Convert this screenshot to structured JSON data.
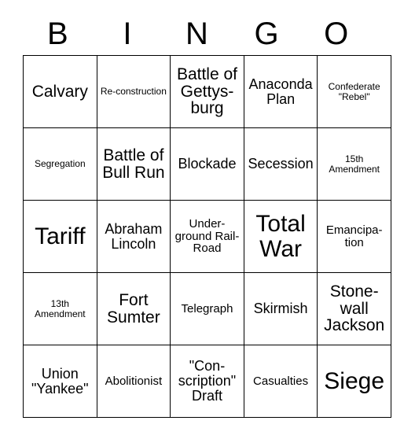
{
  "card": {
    "header_letters": [
      "B",
      "I",
      "N",
      "G",
      "O"
    ],
    "grid_line_color": "#000000",
    "background_color": "#ffffff",
    "text_color": "#000000",
    "rows": [
      [
        {
          "text": "Calvary",
          "size": "lg"
        },
        {
          "text": "Re-construction",
          "size": "xs"
        },
        {
          "text": "Battle of Gettys-burg",
          "size": "lg"
        },
        {
          "text": "Anaconda Plan",
          "size": "md"
        },
        {
          "text": "Confederate \"Rebel\"",
          "size": "xs"
        }
      ],
      [
        {
          "text": "Segregation",
          "size": "xs"
        },
        {
          "text": "Battle of Bull Run",
          "size": "lg"
        },
        {
          "text": "Blockade",
          "size": "md"
        },
        {
          "text": "Secession",
          "size": "md"
        },
        {
          "text": "15th Amendment",
          "size": "xs"
        }
      ],
      [
        {
          "text": "Tariff",
          "size": "xl"
        },
        {
          "text": "Abraham Lincoln",
          "size": "md"
        },
        {
          "text": "Under-ground Rail-Road",
          "size": "sm"
        },
        {
          "text": "Total War",
          "size": "xl"
        },
        {
          "text": "Emancipa-tion",
          "size": "sm"
        }
      ],
      [
        {
          "text": "13th Amendment",
          "size": "xs"
        },
        {
          "text": "Fort Sumter",
          "size": "lg"
        },
        {
          "text": "Telegraph",
          "size": "sm"
        },
        {
          "text": "Skirmish",
          "size": "md"
        },
        {
          "text": "Stone-wall Jackson",
          "size": "lg"
        }
      ],
      [
        {
          "text": "Union \"Yankee\"",
          "size": "md"
        },
        {
          "text": "Abolitionist",
          "size": "sm"
        },
        {
          "text": "\"Con-scription\" Draft",
          "size": "md"
        },
        {
          "text": "Casualties",
          "size": "sm"
        },
        {
          "text": "Siege",
          "size": "xl"
        }
      ]
    ]
  }
}
